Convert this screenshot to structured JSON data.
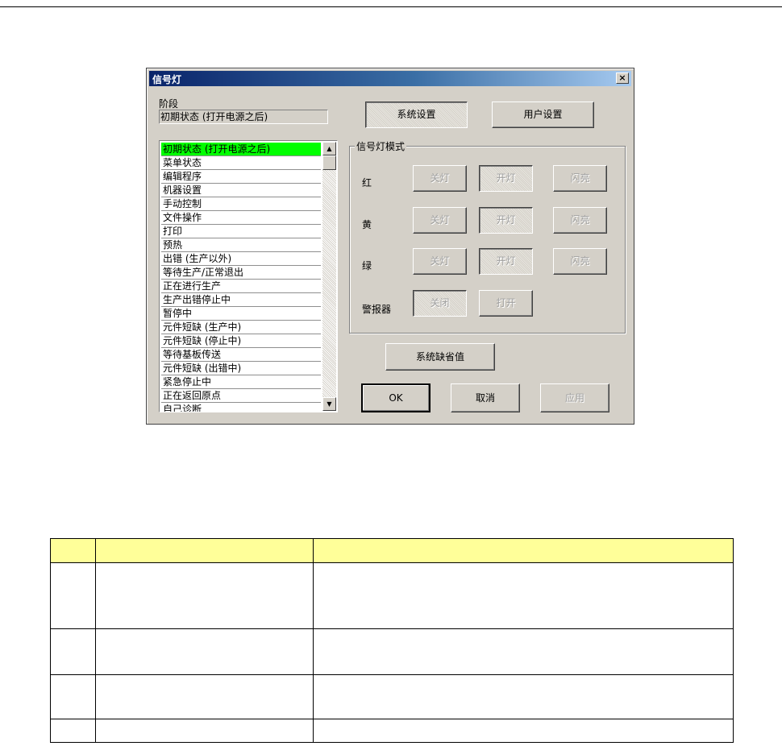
{
  "dialog": {
    "title": "信号灯",
    "close": "×",
    "stage_label": "阶段",
    "stage_value": "初期状态 (打开电源之后)",
    "system_settings": "系统设置",
    "user_settings": "用户设置",
    "list_items": [
      "初期状态 (打开电源之后)",
      "菜单状态",
      "编辑程序",
      "机器设置",
      "手动控制",
      "文件操作",
      "打印",
      "预热",
      "出错 (生产以外)",
      "等待生产/正常退出",
      "正在进行生产",
      "生产出错停止中",
      "暂停中",
      "元件短缺 (生产中)",
      "元件短缺 (停止中)",
      "等待基板传送",
      "元件短缺 (出错中)",
      "紧急停止中",
      "正在返回原点",
      "自己诊断"
    ],
    "selected_index": 0,
    "group_title": "信号灯模式",
    "rows": [
      {
        "label": "红",
        "off": "关灯",
        "on": "开灯",
        "blink": "闪亮"
      },
      {
        "label": "黄",
        "off": "关灯",
        "on": "开灯",
        "blink": "闪亮"
      },
      {
        "label": "绿",
        "off": "关灯",
        "on": "开灯",
        "blink": "闪亮"
      }
    ],
    "buzzer": {
      "label": "警报器",
      "off": "关闭",
      "on": "打开"
    },
    "defaults": "系统缺省值",
    "ok": "OK",
    "cancel": "取消",
    "apply": "应用",
    "highlight_color": "#00ff00"
  },
  "table": {
    "header_color": "#ffff99",
    "rows": 4
  }
}
